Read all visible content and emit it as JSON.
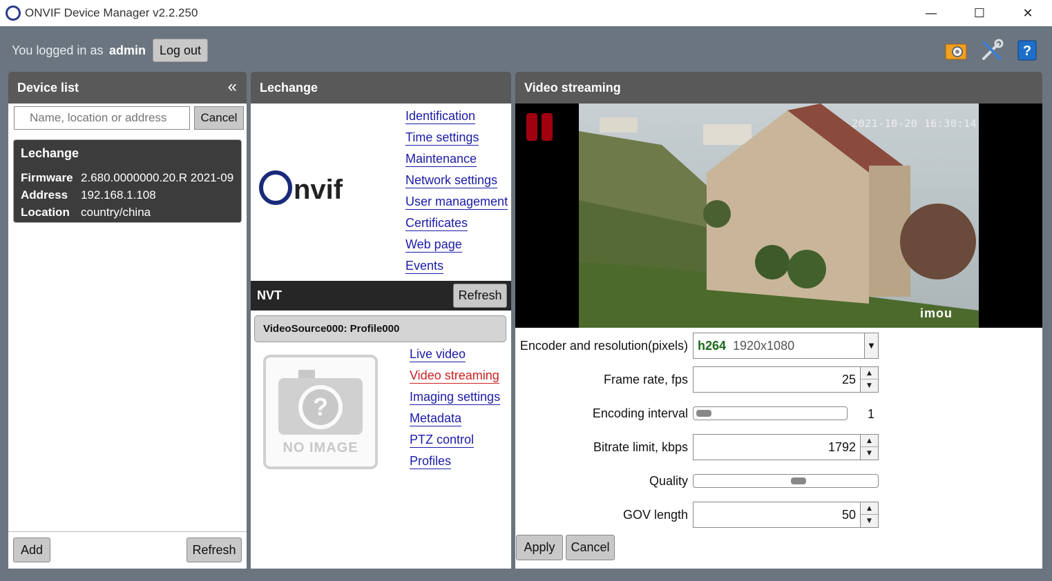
{
  "window": {
    "title": "ONVIF Device Manager v2.2.250",
    "minimize": "—",
    "maximize": "☐",
    "close": "✕"
  },
  "login": {
    "prefix": "You logged in as",
    "user": "admin",
    "logout_label": "Log out"
  },
  "device_list": {
    "title": "Device list",
    "collapse_glyph": "«",
    "search_placeholder": "Name, location or address",
    "cancel_label": "Cancel",
    "selected_device": {
      "name": "Lechange",
      "firmware_key": "Firmware",
      "firmware": "2.680.0000000.20.R 2021-09",
      "address_key": "Address",
      "address": "192.168.1.108",
      "location_key": "Location",
      "location": "country/china"
    },
    "add_label": "Add",
    "refresh_label": "Refresh"
  },
  "device_panel": {
    "title": "Lechange",
    "links": [
      "Identification",
      "Time settings",
      "Maintenance",
      "Network settings",
      "User management",
      "Certificates",
      "Web page",
      "Events"
    ],
    "nvt_title": "NVT",
    "nvt_refresh": "Refresh",
    "profile": "VideoSource000: Profile000",
    "noimage_text": "NO IMAGE",
    "profile_links": [
      "Live video",
      "Video streaming",
      "Imaging settings",
      "Metadata",
      "PTZ control",
      "Profiles"
    ],
    "active_link": "Video streaming"
  },
  "video": {
    "title": "Video streaming",
    "timestamp": "2021-10-20 16:30:14",
    "watermark": "imou",
    "encoder_label": "Encoder and resolution(pixels)",
    "encoder_codec": "h264",
    "encoder_resolution": "1920x1080",
    "framerate_label": "Frame rate, fps",
    "framerate": "25",
    "interval_label": "Encoding interval",
    "interval": "1",
    "bitrate_label": "Bitrate limit, kbps",
    "bitrate": "1792",
    "quality_label": "Quality",
    "quality_fraction": 0.58,
    "gov_label": "GOV length",
    "gov": "50",
    "apply_label": "Apply",
    "cancel_label": "Cancel"
  },
  "colors": {
    "header_bg": "#595959",
    "link": "#1a1aa6",
    "active_link": "#cc2020",
    "codec_text": "#1a6a1a"
  }
}
